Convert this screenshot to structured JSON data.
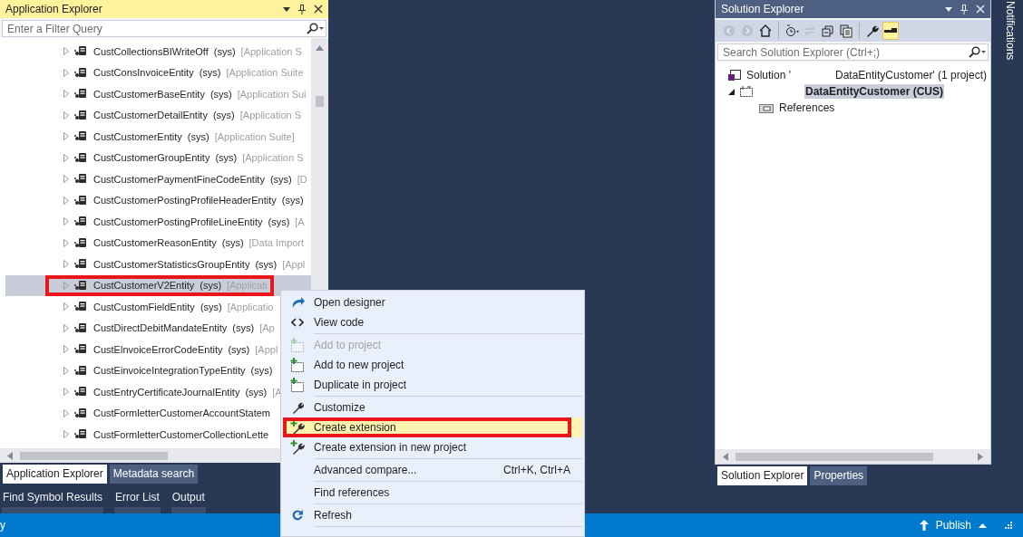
{
  "application_explorer": {
    "title": "Application Explorer",
    "filter": {
      "placeholder": "Enter a Filter Query"
    },
    "items": [
      {
        "name": "CustCollectionsBIWriteOff",
        "layer": "(sys)",
        "model": "[Application S",
        "selected": false,
        "highlighted": false
      },
      {
        "name": "CustConsInvoiceEntity",
        "layer": "(sys)",
        "model": "[Application Suite",
        "selected": false,
        "highlighted": false
      },
      {
        "name": "CustCustomerBaseEntity",
        "layer": "(sys)",
        "model": "[Application Sui",
        "selected": false,
        "highlighted": false
      },
      {
        "name": "CustCustomerDetailEntity",
        "layer": "(sys)",
        "model": "[Application S",
        "selected": false,
        "highlighted": false
      },
      {
        "name": "CustCustomerEntity",
        "layer": "(sys)",
        "model": "[Application Suite]",
        "selected": false,
        "highlighted": false
      },
      {
        "name": "CustCustomerGroupEntity",
        "layer": "(sys)",
        "model": "[Application S",
        "selected": false,
        "highlighted": false
      },
      {
        "name": "CustCustomerPaymentFineCodeEntity",
        "layer": "(sys)",
        "model": "[D",
        "selected": false,
        "highlighted": false
      },
      {
        "name": "CustCustomerPostingProfileHeaderEntity",
        "layer": "(sys)",
        "selected": false,
        "highlighted": false
      },
      {
        "name": "CustCustomerPostingProfileLineEntity",
        "layer": "(sys)",
        "model": "[A",
        "selected": false,
        "highlighted": false
      },
      {
        "name": "CustCustomerReasonEntity",
        "layer": "(sys)",
        "model": "[Data Import",
        "selected": false,
        "highlighted": false
      },
      {
        "name": "CustCustomerStatisticsGroupEntity",
        "layer": "(sys)",
        "model": "[Appl",
        "selected": false,
        "highlighted": false
      },
      {
        "name": "CustCustomerV2Entity",
        "layer": "(sys)",
        "model": "[Applicati",
        "selected": true,
        "highlighted": true
      },
      {
        "name": "CustCustomFieldEntity",
        "layer": "(sys)",
        "model": "[Applicatio",
        "selected": false,
        "highlighted": false
      },
      {
        "name": "CustDirectDebitMandateEntity",
        "layer": "(sys)",
        "model": "[Ap",
        "selected": false,
        "highlighted": false
      },
      {
        "name": "CustElnvoiceErrorCodeEntity",
        "layer": "(sys)",
        "model": "[Appl",
        "selected": false,
        "highlighted": false
      },
      {
        "name": "CustEinvoiceIntegrationTypeEntity",
        "layer": "(sys)",
        "selected": false,
        "highlighted": false
      },
      {
        "name": "CustEntryCertificateJournalEntity",
        "layer": "(sys)",
        "model": "[A",
        "selected": false,
        "highlighted": false
      },
      {
        "name": "CustFormletterCustomerAccountStatem",
        "selected": false,
        "highlighted": false
      },
      {
        "name": "CustFormletterCustomerCollectionLette",
        "selected": false,
        "highlighted": false
      }
    ],
    "tabs": [
      {
        "label": "Application Explorer",
        "selected": true
      },
      {
        "label": "Metadata search",
        "selected": false
      }
    ]
  },
  "bottom_tabs": [
    {
      "label": "Find Symbol Results"
    },
    {
      "label": "Error List"
    },
    {
      "label": "Output"
    }
  ],
  "context_menu": {
    "items": [
      {
        "kind": "open",
        "label": "Open designer",
        "disabled": false,
        "selected": false,
        "highlighted": false
      },
      {
        "kind": "code",
        "label": "View code",
        "disabled": false,
        "selected": false,
        "highlighted": false
      },
      {
        "kind": "separator"
      },
      {
        "kind": "add",
        "label": "Add to project",
        "disabled": true,
        "selected": false,
        "highlighted": false
      },
      {
        "kind": "add",
        "label": "Add to new project",
        "disabled": false,
        "selected": false,
        "highlighted": false
      },
      {
        "kind": "add",
        "label": "Duplicate in project",
        "disabled": false,
        "selected": false,
        "highlighted": false
      },
      {
        "kind": "separator"
      },
      {
        "kind": "customize",
        "label": "Customize",
        "disabled": false,
        "selected": false,
        "highlighted": false
      },
      {
        "kind": "extension",
        "label": "Create extension",
        "disabled": false,
        "selected": true,
        "highlighted": true
      },
      {
        "kind": "extension",
        "label": "Create extension in new project",
        "disabled": false,
        "selected": false,
        "highlighted": false
      },
      {
        "kind": "separator"
      },
      {
        "kind": "plain",
        "label": "Advanced compare...",
        "shortcut": "Ctrl+K, Ctrl+A",
        "disabled": false,
        "selected": false,
        "highlighted": false
      },
      {
        "kind": "separator"
      },
      {
        "kind": "plain",
        "label": "Find references",
        "disabled": false,
        "selected": false,
        "highlighted": false
      },
      {
        "kind": "separator"
      },
      {
        "kind": "refresh",
        "label": "Refresh",
        "disabled": false,
        "selected": false,
        "highlighted": false
      },
      {
        "kind": "separator"
      }
    ]
  },
  "solution_explorer": {
    "title": "Solution Explorer",
    "toolbar": [
      {
        "kind": "back",
        "disabled": true,
        "pressed": false
      },
      {
        "kind": "forward",
        "disabled": true,
        "pressed": false
      },
      {
        "kind": "home",
        "disabled": false,
        "pressed": false
      },
      {
        "kind": "separator"
      },
      {
        "kind": "history",
        "disabled": false,
        "pressed": false
      },
      {
        "kind": "sync",
        "disabled": true,
        "pressed": false
      },
      {
        "kind": "collapse",
        "disabled": false,
        "pressed": false
      },
      {
        "kind": "showall",
        "disabled": false,
        "pressed": false
      },
      {
        "kind": "separator"
      },
      {
        "kind": "wrench",
        "disabled": false,
        "pressed": false
      },
      {
        "kind": "preview",
        "disabled": false,
        "pressed": true
      }
    ],
    "search": {
      "placeholder": "Search Solution Explorer (Ctrl+;)"
    },
    "tree": [
      {
        "kind": "solution",
        "label": "Solution '",
        "suffix": "DataEntityCustomer' (1 project)",
        "selected": false,
        "children": [
          {
            "kind": "project",
            "label": "DataEntityCustomer (CUS)",
            "selected": true,
            "expanded": true,
            "children": [
              {
                "kind": "references",
                "label": "References",
                "selected": false
              }
            ]
          }
        ]
      }
    ],
    "tabs": [
      {
        "label": "Solution Explorer",
        "selected": true
      },
      {
        "label": "Properties",
        "selected": false
      }
    ]
  },
  "notifications": {
    "label": "Notifications"
  },
  "status_bar": {
    "text": "y",
    "publish": "Publish"
  }
}
